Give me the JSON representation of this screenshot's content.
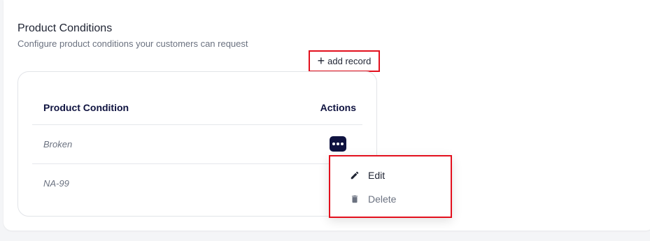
{
  "section": {
    "title": "Product Conditions",
    "subtitle": "Configure product conditions your customers can request"
  },
  "toolbar": {
    "add_icon": "plus-icon",
    "add_label": "add record"
  },
  "table": {
    "columns": [
      "Product Condition",
      "Actions"
    ],
    "rows": [
      {
        "condition": "Broken"
      },
      {
        "condition": "NA-99"
      }
    ],
    "actions_icon": "more-horizontal-icon"
  },
  "menu": {
    "items": [
      {
        "label": "Edit",
        "icon": "pencil-icon"
      },
      {
        "label": "Delete",
        "icon": "trash-icon"
      }
    ]
  },
  "colors": {
    "primary": "#0f1340",
    "highlight": "#e3101d",
    "muted": "#6b7280"
  }
}
